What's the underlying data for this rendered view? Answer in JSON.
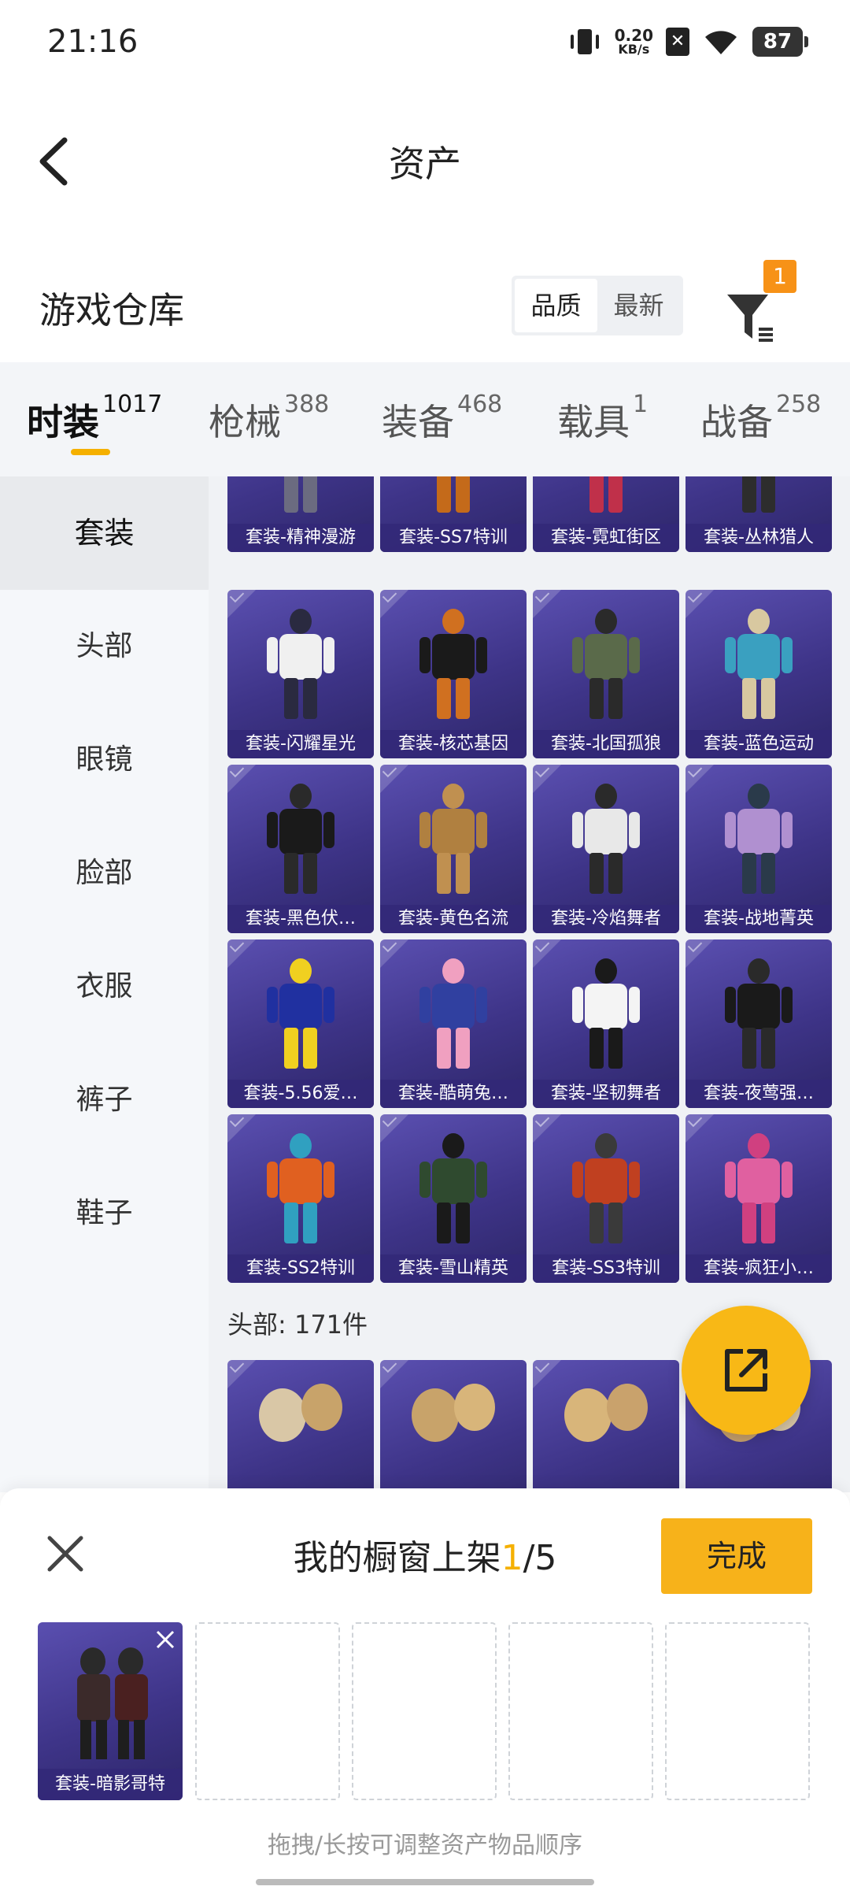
{
  "status_bar": {
    "time": "21:16",
    "net_speed_value": "0.20",
    "net_speed_unit": "KB/s",
    "battery": "87",
    "icons": [
      "vibrate-icon",
      "sim-off-icon",
      "wifi-icon",
      "battery-icon"
    ]
  },
  "header": {
    "title": "资产",
    "back_icon": "chevron-left-icon"
  },
  "warehouse": {
    "title": "游戏仓库",
    "sort_options": [
      "品质",
      "最新"
    ],
    "sort_selected": "品质",
    "filter_badge": "1",
    "filter_icon": "filter-icon"
  },
  "categories": [
    {
      "label": "时装",
      "count": "1017",
      "active": true
    },
    {
      "label": "枪械",
      "count": "388",
      "active": false
    },
    {
      "label": "装备",
      "count": "468",
      "active": false
    },
    {
      "label": "载具",
      "count": "1",
      "active": false
    },
    {
      "label": "战备",
      "count": "258",
      "active": false
    }
  ],
  "sidebar": {
    "items": [
      {
        "label": "套装",
        "active": true
      },
      {
        "label": "头部",
        "active": false
      },
      {
        "label": "眼镜",
        "active": false
      },
      {
        "label": "脸部",
        "active": false
      },
      {
        "label": "衣服",
        "active": false
      },
      {
        "label": "裤子",
        "active": false
      },
      {
        "label": "鞋子",
        "active": false
      }
    ]
  },
  "grid": {
    "rows": [
      [
        "套装-精神漫游",
        "套装-SS7特训",
        "套装-霓虹街区",
        "套装-丛林猎人"
      ],
      [
        "套装-闪耀星光",
        "套装-核芯基因",
        "套装-北国孤狼",
        "套装-蓝色运动"
      ],
      [
        "套装-黑色伏…",
        "套装-黄色名流",
        "套装-冷焰舞者",
        "套装-战地菁英"
      ],
      [
        "套装-5.56爱…",
        "套装-酷萌兔…",
        "套装-坚韧舞者",
        "套装-夜莺强…"
      ],
      [
        "套装-SS2特训",
        "套装-雪山精英",
        "套装-SS3特训",
        "套装-疯狂小…"
      ]
    ],
    "head_section_title": "头部: 171件"
  },
  "fab": {
    "icon": "share-external-icon"
  },
  "shelf": {
    "title_prefix": "我的橱窗上架",
    "current": "1",
    "total_sep": "/5",
    "done_label": "完成",
    "close_icon": "close-icon",
    "slots": [
      {
        "label": "套装-暗影哥特",
        "filled": true
      },
      {
        "label": "",
        "filled": false
      },
      {
        "label": "",
        "filled": false
      },
      {
        "label": "",
        "filled": false
      },
      {
        "label": "",
        "filled": false
      }
    ],
    "hint": "拖拽/长按可调整资产物品顺序"
  }
}
